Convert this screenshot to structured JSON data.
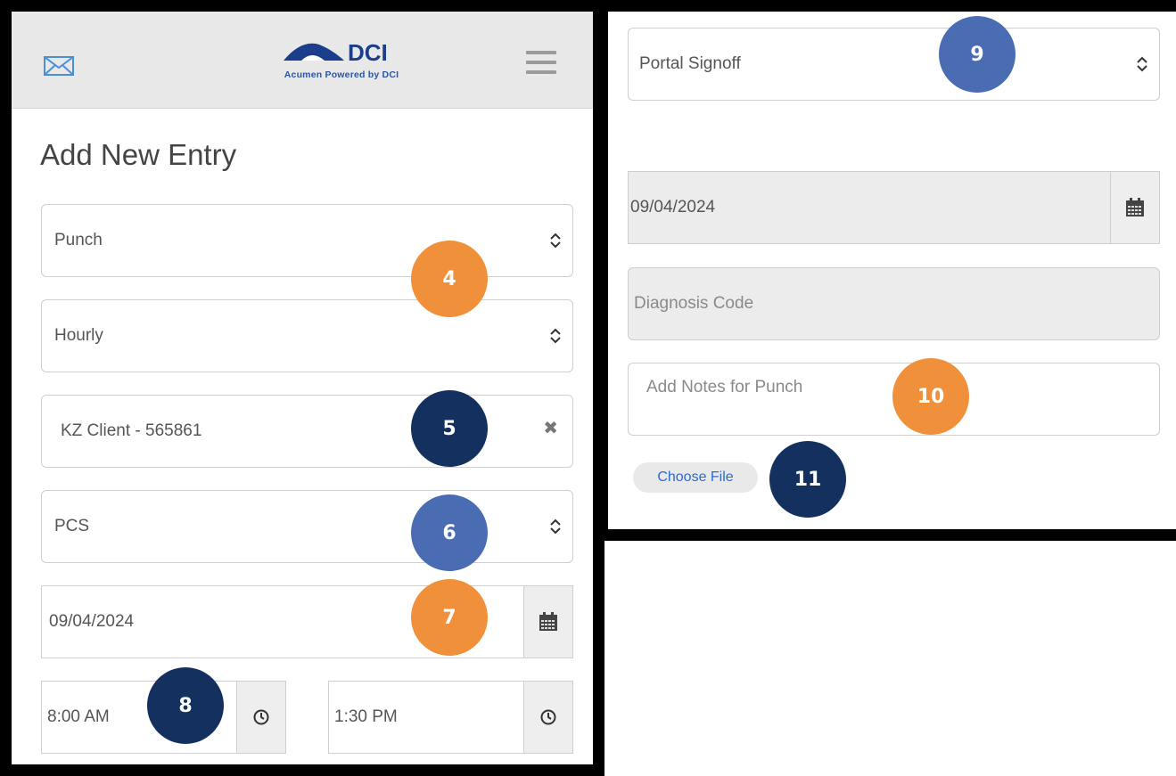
{
  "header": {
    "logo_brand": "DCI",
    "logo_subtitle": "Acumen Powered by DCI",
    "mail_icon": "envelope-icon",
    "menu_icon": "hamburger-menu-icon"
  },
  "left": {
    "title": "Add New Entry",
    "entry_type": "Punch",
    "billing_type": "Hourly",
    "client": "KZ Client - 565861",
    "service": "PCS",
    "date": "09/04/2024",
    "start_time": "8:00 AM",
    "end_time": "1:30 PM"
  },
  "right": {
    "signoff": "Portal Signoff",
    "date": "09/04/2024",
    "diagnosis_placeholder": "Diagnosis Code",
    "notes_placeholder": "Add Notes for Punch",
    "choose_file": "Choose File"
  },
  "badges": {
    "b4": "4",
    "b5": "5",
    "b6": "6",
    "b7": "7",
    "b8": "8",
    "b9": "9",
    "b10": "10",
    "b11": "11"
  },
  "colors": {
    "badge_orange": "#f0903a",
    "badge_navy": "#14305e",
    "badge_blue": "#4a6cb3",
    "brand_blue": "#2a56a8",
    "link_blue": "#2a6ad6"
  }
}
